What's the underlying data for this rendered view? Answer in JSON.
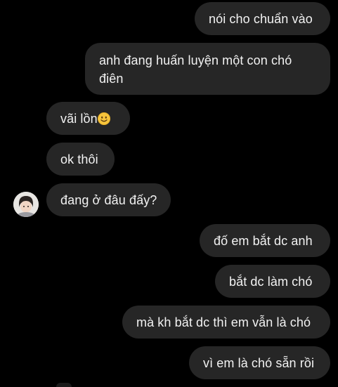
{
  "conversation": {
    "messages": [
      {
        "sender": "self",
        "text": "nói cho chuẩn vào"
      },
      {
        "sender": "self",
        "text": "anh đang huấn luyện một con chó điên"
      },
      {
        "sender": "other",
        "text": "vãi lồn",
        "emoji": "slightly-smiling-face-icon"
      },
      {
        "sender": "other",
        "text": "ok thôi"
      },
      {
        "sender": "other",
        "text": "đang ở đâu đấy?"
      },
      {
        "sender": "self",
        "text": "đố em bắt dc anh"
      },
      {
        "sender": "self",
        "text": "bắt dc làm chó"
      },
      {
        "sender": "self",
        "text": "mà kh bắt dc thì em vẫn là chó"
      },
      {
        "sender": "self",
        "text": "vì em là chó sẵn rồi"
      }
    ]
  },
  "theme": {
    "background": "#000000",
    "bubble": "#262626",
    "text": "#f2f2f2"
  },
  "icons": {
    "contact_avatar": "contact-avatar-photo"
  }
}
